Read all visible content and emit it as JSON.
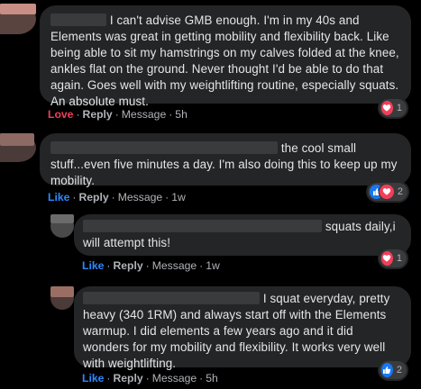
{
  "comments": [
    {
      "text": "I can't advise GMB enough. I'm in my 40s and Elements was great in getting mobility and flexibility back. Like being able to sit my hamstrings on my calves folded at the knee, ankles flat on the ground. Never thought I'd be able to do that again. Goes well with my weightlifting routine, especially squats. An absolute must.",
      "reaction_label": "Love",
      "reply_label": "Reply",
      "message_label": "Message",
      "time": "5h",
      "reaction_count": "1",
      "reaction_icons": [
        "heart-icon"
      ]
    },
    {
      "text_line1": "the cool small",
      "text_rest": "stuff...even five minutes a day. I'm also doing this to keep up my mobility.",
      "reaction_label": "Like",
      "reply_label": "Reply",
      "message_label": "Message",
      "time": "1w",
      "reaction_count": "2",
      "reaction_icons": [
        "thumbs-up-icon",
        "heart-icon"
      ]
    },
    {
      "text_line1": "squats daily,i",
      "text_rest": "will attempt this!",
      "reaction_label": "Like",
      "reply_label": "Reply",
      "message_label": "Message",
      "time": "1w",
      "reaction_count": "1",
      "reaction_icons": [
        "heart-icon"
      ]
    },
    {
      "text_line1": "I squat everyday, pretty",
      "text_rest": "heavy (340 1RM) and always start off with the Elements warmup. I did elements a few years ago and it did wonders for my mobility and flexibility. It works very well with weightlifting.",
      "reaction_label": "Like",
      "reply_label": "Reply",
      "message_label": "Message",
      "time": "5h",
      "reaction_count": "2",
      "reaction_icons": [
        "thumbs-up-icon"
      ]
    }
  ],
  "colors": {
    "background": "#000000",
    "bubble": "#242526",
    "text": "#e4e6eb",
    "meta": "#b0b3b8",
    "love": "#f33e58",
    "like": "#2d88ff"
  }
}
